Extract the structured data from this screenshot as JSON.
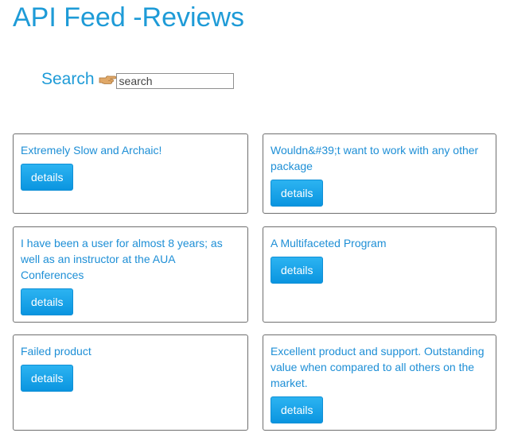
{
  "header": {
    "title": "API Feed -Reviews"
  },
  "search": {
    "label": "Search",
    "icon": "pointing-hand-icon",
    "value": "",
    "placeholder": "search"
  },
  "colors": {
    "accent": "#1e9bd7",
    "button": "#0a95e0",
    "border": "#6f6f6f"
  },
  "reviews": [
    {
      "title": "Extremely Slow and Archaic!",
      "button_label": "details"
    },
    {
      "title": "Wouldn&#39;t want to work with any other package",
      "button_label": "details"
    },
    {
      "title": "I have been a user for almost 8 years; as well as an instructor at the AUA Conferences",
      "button_label": "details"
    },
    {
      "title": "A Multifaceted Program",
      "button_label": "details"
    },
    {
      "title": "Failed product",
      "button_label": "details"
    },
    {
      "title": "Excellent product and support. Outstanding value when compared to all others on the market.",
      "button_label": "details"
    }
  ]
}
